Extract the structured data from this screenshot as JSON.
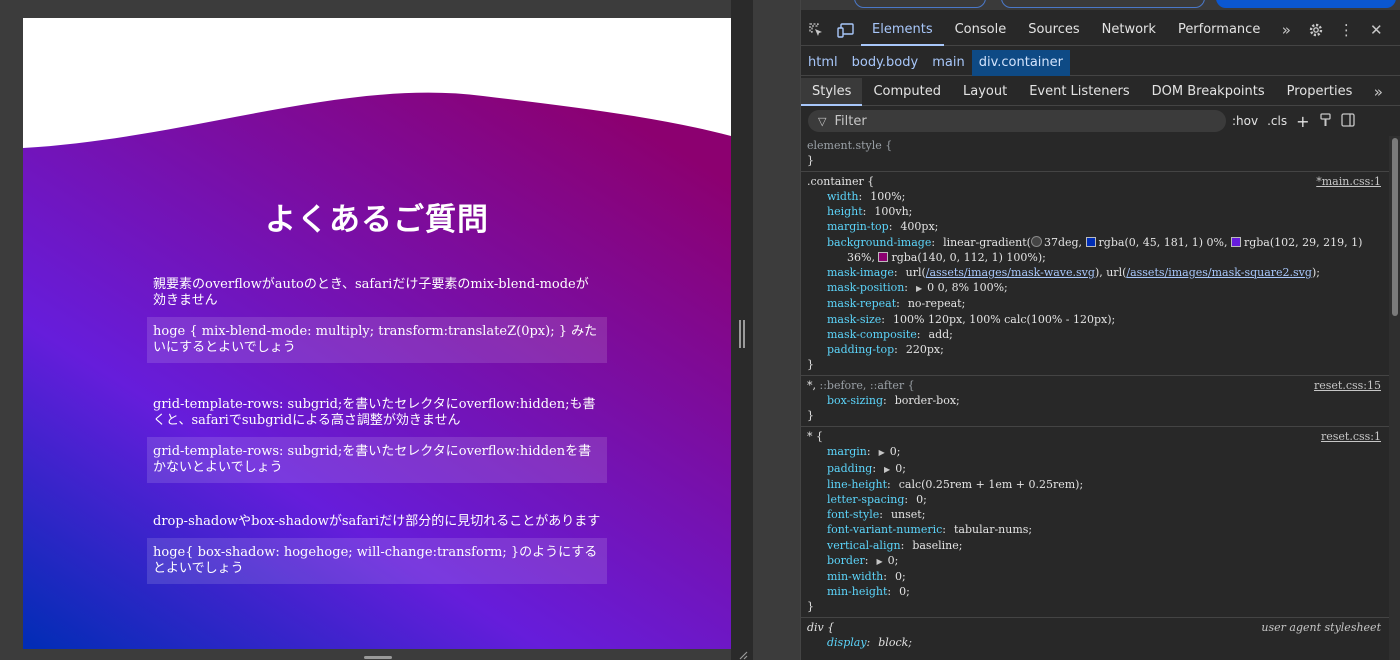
{
  "faq": {
    "title": "よくあるご質問",
    "items": [
      {
        "q": "親要素のoverflowがautoのとき、safariだけ子要素のmix-blend-modeが効きません",
        "a": "hoge { mix-blend-mode: multiply; transform:translateZ(0px); } みたいにするとよいでしょう"
      },
      {
        "q": "grid-template-rows: subgrid;を書いたセレクタにoverflow:hidden;も書くと、safariでsubgridによる高さ調整が効きません",
        "a": "grid-template-rows: subgrid;を書いたセレクタにoverflow:hiddenを書かないとよいでしょう"
      },
      {
        "q": "drop-shadowやbox-shadowがsafariだけ部分的に見切れることがあります",
        "a": "hoge{ box-shadow: hogehoge; will-change:transform; }のようにするとよいでしょう"
      }
    ],
    "gradient": {
      "start": "#002db5",
      "mid": "#661ddb",
      "end": "#8c0070"
    }
  },
  "devtools": {
    "tabs": [
      "Elements",
      "Console",
      "Sources",
      "Network",
      "Performance"
    ],
    "breadcrumbs": [
      "html",
      "body.body",
      "main",
      "div.container"
    ],
    "subtabs": [
      "Styles",
      "Computed",
      "Layout",
      "Event Listeners",
      "DOM Breakpoints",
      "Properties"
    ],
    "filter_placeholder": "Filter",
    "hov_label": ":hov",
    "cls_label": ".cls",
    "rules": {
      "element_style": {
        "selector": "element.style {",
        "close": "}"
      },
      "container": {
        "selector": ".container {",
        "source": "*main.css:1",
        "width": "100%;",
        "height": "100vh;",
        "margin_top": "400px;",
        "bg_fn": "linear-gradient(",
        "bg_angle": "37deg,",
        "bg_c1": "rgba(0, 45, 181, 1) 0%,",
        "bg_c2": "rgba(102, 29, 219, 1) 36%,",
        "bg_c3": "rgba(140, 0, 112, 1) 100%);",
        "mask_url1": "/assets/images/mask-wave.svg",
        "mask_url2": "/assets/images/mask-square2.svg",
        "mask_position": "0 0, 8% 100%;",
        "mask_repeat": "no-repeat;",
        "mask_size": "100% 120px, 100% calc(100% - 120px);",
        "mask_composite": "add;",
        "padding_top": "220px;",
        "swatch_c1": "#002db5",
        "swatch_c2": "#661ddb",
        "swatch_c3": "#8c0070"
      },
      "star_pseudo": {
        "sel1": "*,",
        "sel2": "::before, ::after {",
        "source": "reset.css:15",
        "box_sizing": "border-box;"
      },
      "star": {
        "selector": "* {",
        "source": "reset.css:1",
        "margin": "0;",
        "padding": "0;",
        "line_height": "calc(0.25rem + 1em + 0.25rem);",
        "letter_spacing": "0;",
        "font_style": "unset;",
        "font_variant_numeric": "tabular-nums;",
        "vertical_align": "baseline;",
        "border": "0;",
        "min_width": "0;",
        "min_height": "0;"
      },
      "div": {
        "selector": "div {",
        "source": "user agent stylesheet",
        "display": "block;"
      }
    }
  }
}
